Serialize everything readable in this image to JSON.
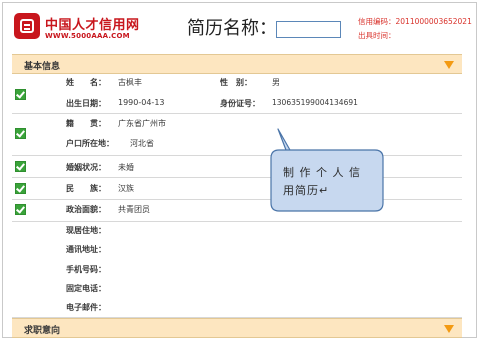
{
  "header": {
    "logo_text": "中国人才信用网",
    "logo_url": "WWW.5000AAA.COM",
    "resume_title": "简历名称：",
    "credit_code": "信用编码：2011000003652021",
    "issue_time": "出具时间："
  },
  "sections": {
    "basic": "基本信息",
    "job": "求职意向"
  },
  "rows": {
    "name_label": "姓　　名：",
    "name_value": "古枫丰",
    "gender_label": "性　别：",
    "gender_value": "男",
    "birth_label": "出生日期：",
    "birth_value": "1990-04-13",
    "id_label": "身份证号：",
    "id_value": "130635199004134691",
    "native_label": "籍　　贯：",
    "native_value": "广东省广州市",
    "hukou_label": "户口所在地：",
    "hukou_value": "河北省",
    "marital_label": "婚姻状况：",
    "marital_value": "未婚",
    "ethnic_label": "民　　族：",
    "ethnic_value": "汉族",
    "political_label": "政治面貌：",
    "political_value": "共青团员",
    "residence_label": "现居住地：",
    "address_label": "通讯地址：",
    "mobile_label": "手机号码：",
    "phone_label": "固定电话：",
    "email_label": "电子邮件："
  },
  "callout": {
    "text": "制 作 个 人 信用简历↵"
  },
  "colors": {
    "brand_red": "#c8161d",
    "section_bg": "#fde6c0",
    "arrow": "#f39a12",
    "callout_fill": "#c7d8ef",
    "callout_stroke": "#4a74a8"
  }
}
